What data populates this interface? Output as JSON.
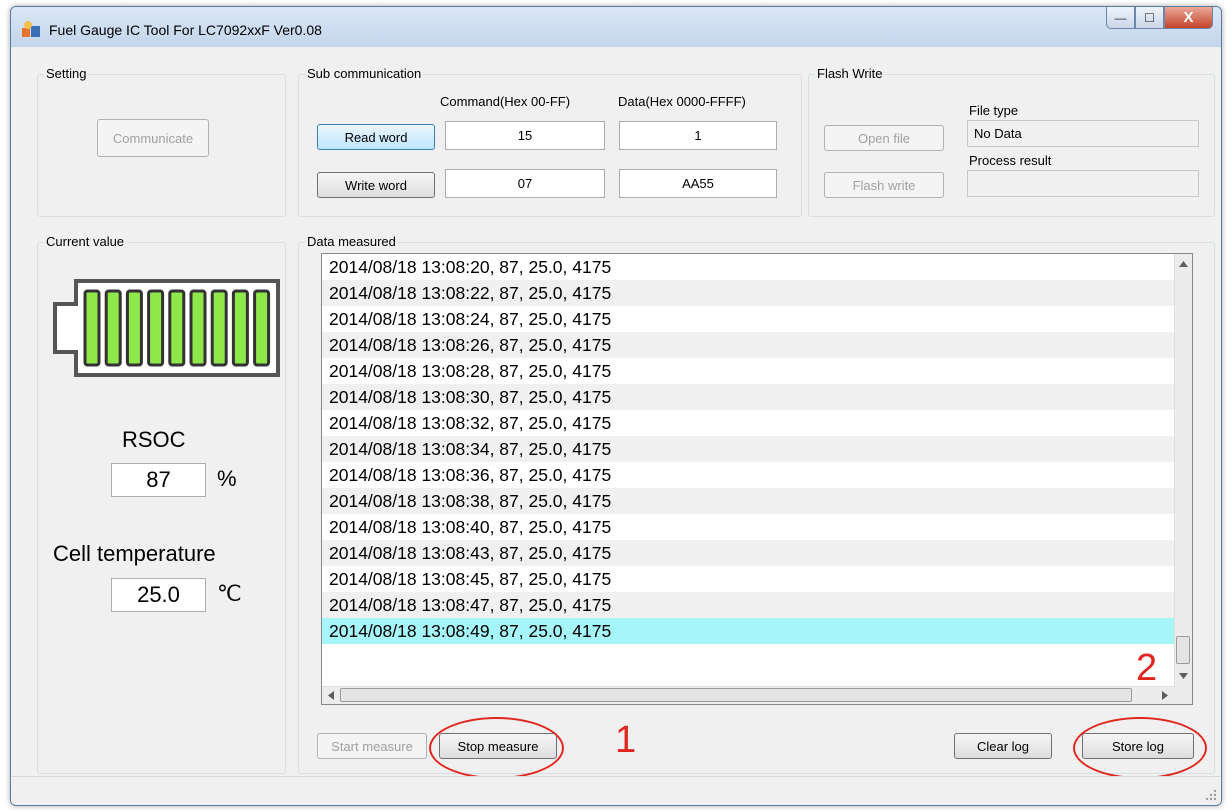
{
  "window": {
    "title": "Fuel Gauge IC Tool For LC7092xxF Ver0.08",
    "minimize_glyph": "—",
    "maximize_glyph": "☐",
    "close_glyph": "X"
  },
  "setting": {
    "label": "Setting",
    "communicate_button": "Communicate"
  },
  "sub_communication": {
    "label": "Sub communication",
    "command_header": "Command(Hex 00-FF)",
    "data_header": "Data(Hex 0000-FFFF)",
    "read_word_button": "Read word",
    "write_word_button": "Write word",
    "read_command": "15",
    "read_data": "1",
    "write_command": "07",
    "write_data": "AA55"
  },
  "flash_write": {
    "label": "Flash Write",
    "open_file_button": "Open file",
    "flash_write_button": "Flash write",
    "file_type_label": "File type",
    "file_type_value": "No Data",
    "process_result_label": "Process result",
    "process_result_value": ""
  },
  "current_value": {
    "label": "Current value",
    "battery_bars": 9,
    "battery_color": "#8fe84a",
    "rsoc_label": "RSOC",
    "rsoc_value": "87",
    "rsoc_unit": "%",
    "temp_label": "Cell temperature",
    "temp_value": "25.0",
    "temp_unit": "℃"
  },
  "data_measured": {
    "label": "Data measured",
    "rows": [
      "2014/08/18 13:08:20, 87, 25.0, 4175",
      "2014/08/18 13:08:22, 87, 25.0, 4175",
      "2014/08/18 13:08:24, 87, 25.0, 4175",
      "2014/08/18 13:08:26, 87, 25.0, 4175",
      "2014/08/18 13:08:28, 87, 25.0, 4175",
      "2014/08/18 13:08:30, 87, 25.0, 4175",
      "2014/08/18 13:08:32, 87, 25.0, 4175",
      "2014/08/18 13:08:34, 87, 25.0, 4175",
      "2014/08/18 13:08:36, 87, 25.0, 4175",
      "2014/08/18 13:08:38, 87, 25.0, 4175",
      "2014/08/18 13:08:40, 87, 25.0, 4175",
      "2014/08/18 13:08:43, 87, 25.0, 4175",
      "2014/08/18 13:08:45, 87, 25.0, 4175",
      "2014/08/18 13:08:47, 87, 25.0, 4175",
      "2014/08/18 13:08:49, 87, 25.0, 4175"
    ],
    "selected_row_index": 14,
    "start_measure_button": "Start measure",
    "stop_measure_button": "Stop measure",
    "clear_log_button": "Clear log",
    "store_log_button": "Store log"
  },
  "annotations": {
    "marker_1": "1",
    "marker_2": "2",
    "color": "#e0261f"
  }
}
